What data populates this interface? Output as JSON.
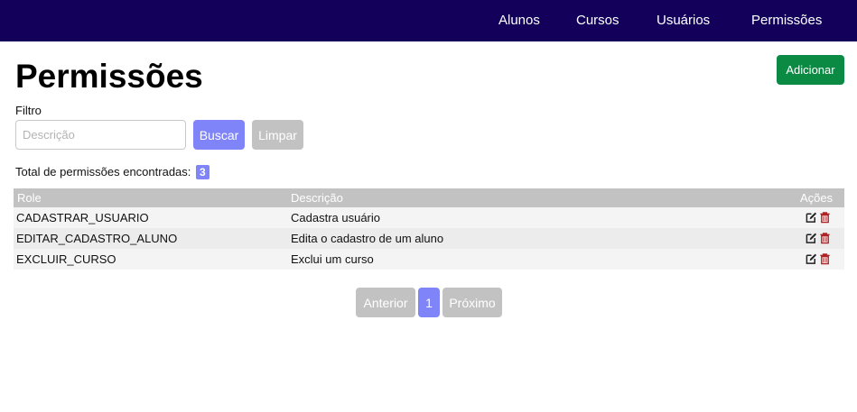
{
  "nav": {
    "items": [
      "Alunos",
      "Cursos",
      "Usuários",
      "Permissões"
    ]
  },
  "page": {
    "title": "Permissões",
    "add_label": "Adicionar"
  },
  "filter": {
    "label": "Filtro",
    "placeholder": "Descrição",
    "value": "",
    "search_label": "Buscar",
    "clear_label": "Limpar"
  },
  "summary": {
    "text": "Total de permissões encontradas:",
    "count": "3"
  },
  "table": {
    "headers": {
      "role": "Role",
      "description": "Descrição",
      "actions": "Ações"
    },
    "rows": [
      {
        "role": "CADASTRAR_USUARIO",
        "description": "Cadastra usuário"
      },
      {
        "role": "EDITAR_CADASTRO_ALUNO",
        "description": "Edita o cadastro de um aluno"
      },
      {
        "role": "EXCLUIR_CURSO",
        "description": "Exclui um curso"
      }
    ],
    "row_actions": [
      "edit-icon",
      "trash-icon"
    ]
  },
  "pagination": {
    "prev_label": "Anterior",
    "current_page": "1",
    "next_label": "Próximo"
  },
  "colors": {
    "navbar": "#12005a",
    "primary": "#7f84f8",
    "success": "#0b8a44",
    "disabled": "#c2c2c2",
    "danger": "#b22222"
  }
}
